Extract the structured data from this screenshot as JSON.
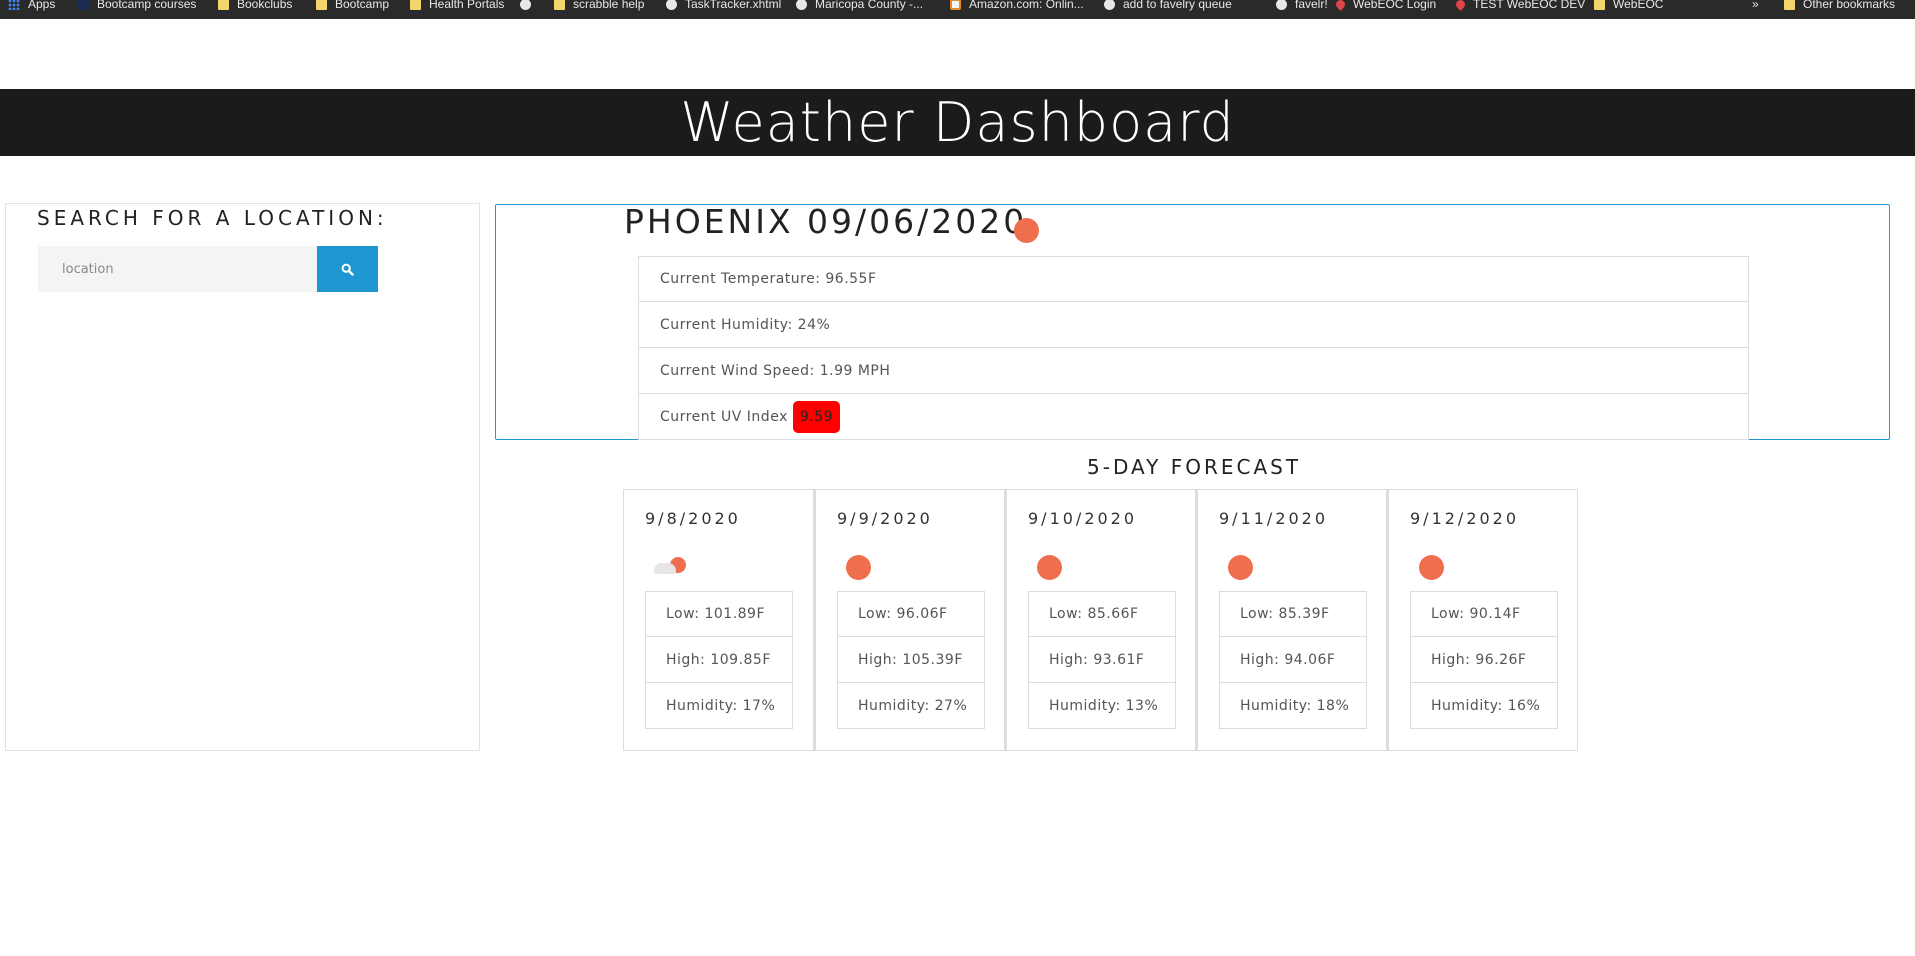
{
  "bookmarks_bar": {
    "items": [
      {
        "label": "Apps",
        "icon": "apps-grid-icon"
      },
      {
        "label": "Bootcamp courses",
        "icon": "bookmark-icon"
      },
      {
        "label": "Bookclubs",
        "icon": "folder-icon"
      },
      {
        "label": "Bootcamp",
        "icon": "folder-icon"
      },
      {
        "label": "Health Portals",
        "icon": "folder-icon"
      },
      {
        "label": "",
        "icon": "globe-icon"
      },
      {
        "label": "scrabble help",
        "icon": "folder-icon"
      },
      {
        "label": "TaskTracker.xhtml",
        "icon": "globe-icon"
      },
      {
        "label": "Maricopa County -...",
        "icon": "globe-icon"
      },
      {
        "label": "Amazon.com: Onlin...",
        "icon": "amazon-icon"
      },
      {
        "label": "add to favelry queue",
        "icon": "globe-icon"
      },
      {
        "label": "favelr!",
        "icon": "globe-icon"
      },
      {
        "label": "WebEOC Login",
        "icon": "pin-icon"
      },
      {
        "label": "TEST WebEOC DEV",
        "icon": "pin-icon"
      },
      {
        "label": "WebEOC",
        "icon": "folder-icon"
      },
      {
        "label": "»",
        "icon": ""
      },
      {
        "label": "Other bookmarks",
        "icon": "folder-icon"
      }
    ]
  },
  "header": {
    "title": "Weather Dashboard"
  },
  "search": {
    "heading": "SEARCH FOR A LOCATION:",
    "placeholder": "location",
    "value": "",
    "button_icon": "search-icon"
  },
  "current": {
    "city_date": "PHOENIX 09/06/2020",
    "icon": "sun-icon",
    "temperature": "Current Temperature: 96.55F",
    "humidity": "Current Humidity: 24%",
    "wind": "Current Wind Speed: 1.99 MPH",
    "uv_label": "Current UV Index",
    "uv_value": "9.59",
    "uv_color": "#ff0000"
  },
  "forecast": {
    "title": "5-DAY FORECAST",
    "days": [
      {
        "date": "9/8/2020",
        "icon": "partly-cloudy-icon",
        "low": "Low: 101.89F",
        "high": "High: 109.85F",
        "humidity": "Humidity: 17%"
      },
      {
        "date": "9/9/2020",
        "icon": "sun-icon",
        "low": "Low: 96.06F",
        "high": "High: 105.39F",
        "humidity": "Humidity: 27%"
      },
      {
        "date": "9/10/2020",
        "icon": "sun-icon",
        "low": "Low: 85.66F",
        "high": "High: 93.61F",
        "humidity": "Humidity: 13%"
      },
      {
        "date": "9/11/2020",
        "icon": "sun-icon",
        "low": "Low: 85.39F",
        "high": "High: 94.06F",
        "humidity": "Humidity: 18%"
      },
      {
        "date": "9/12/2020",
        "icon": "sun-icon",
        "low": "Low: 90.14F",
        "high": "High: 96.26F",
        "humidity": "Humidity: 16%"
      }
    ]
  },
  "colors": {
    "header_bg": "#1b1b1b",
    "accent": "#1e96d0",
    "sun": "#ee6e4e"
  }
}
